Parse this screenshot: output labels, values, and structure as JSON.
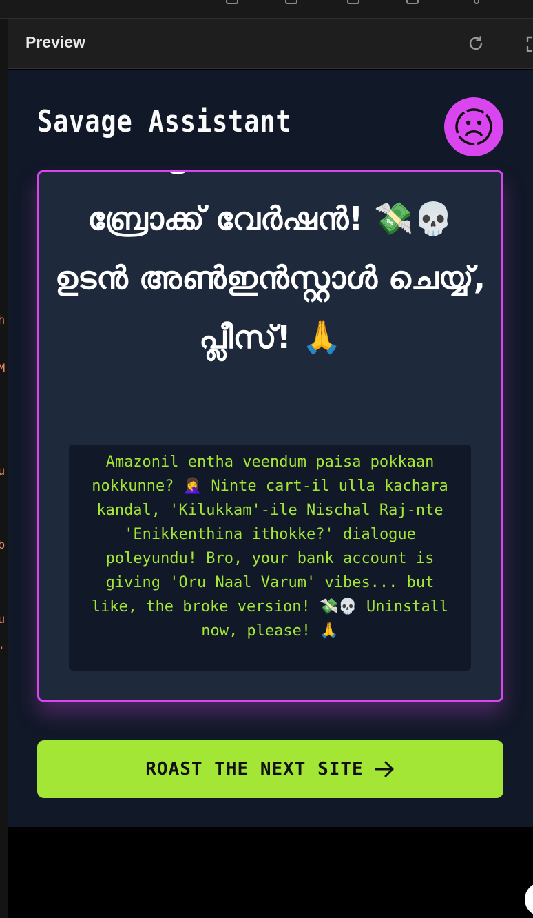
{
  "preview": {
    "title": "Preview"
  },
  "app": {
    "title": "Savage Assistant",
    "avatar_icon": "sad-face-icon",
    "accent_color": "#d946ef",
    "action_color": "#a3e635"
  },
  "card": {
    "headline": "ബ്രോക്ക് വേർഷൻ! 💸💀 ഉടൻ അൺഇൻസ്റ്റാൾ ചെയ്യ്, പ്ലീസ്! 🙏",
    "roast_text": "Amazonil entha veendum paisa pokkaan nokkunne? 🤦‍♀️ Ninte cart-il ulla kachara kandal, 'Kilukkam'-ile Nischal Raj-nte 'Enikkenthina ithokke?' dialogue poleyundu! Bro, your bank account is giving 'Oru Naal Varum' vibes... but like, the broke version! 💸💀 Uninstall now, please! 🙏"
  },
  "next_button": {
    "label": "ROAST THE NEXT SITE",
    "icon": "arrow-right-icon"
  },
  "editor_gutter": [
    {
      "char": "h",
      "color": "#e0876a"
    },
    {
      "char": "M",
      "color": "#e0876a"
    },
    {
      "char": "u",
      "color": "#e0876a"
    },
    {
      "char": "b",
      "color": "#e0876a"
    },
    {
      "char": "u",
      "color": "#e0876a"
    },
    {
      "char": ".",
      "color": "#e0876a"
    }
  ]
}
